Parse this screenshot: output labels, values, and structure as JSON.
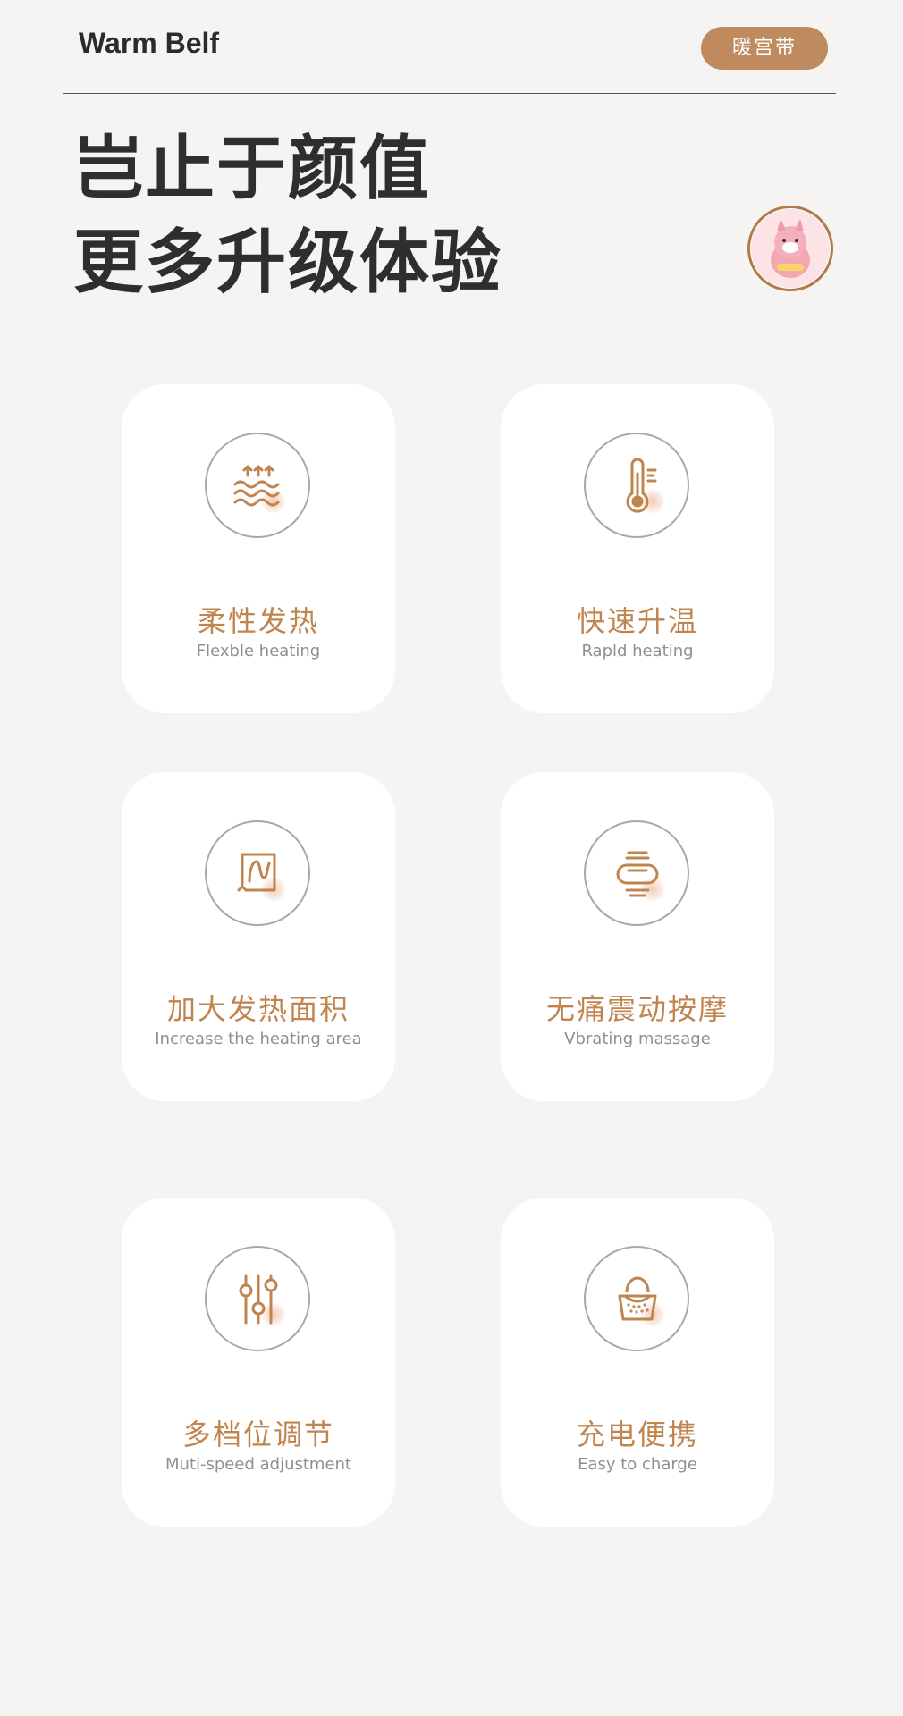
{
  "header": {
    "brand": "Warm Belf",
    "tag": "暖宫带"
  },
  "headline": {
    "line1": "岂止于颜值",
    "line2": "更多升级体验"
  },
  "features": [
    {
      "title": "柔性发热",
      "subtitle": "Flexble heating",
      "icon": "heat-waves-icon"
    },
    {
      "title": "快速升温",
      "subtitle": "Rapld heating",
      "icon": "thermometer-icon"
    },
    {
      "title": "加大发热面积",
      "subtitle": "Increase the heating area",
      "icon": "heating-area-icon"
    },
    {
      "title": "无痛震动按摩",
      "subtitle": "Vbrating massage",
      "icon": "vibration-icon"
    },
    {
      "title": "多档位调节",
      "subtitle": "Muti-speed adjustment",
      "icon": "sliders-icon"
    },
    {
      "title": "充电便携",
      "subtitle": "Easy to charge",
      "icon": "bag-icon"
    }
  ],
  "colors": {
    "accent": "#c0844f",
    "tag_bg": "#be8a5e",
    "background": "#f5f4f2"
  }
}
